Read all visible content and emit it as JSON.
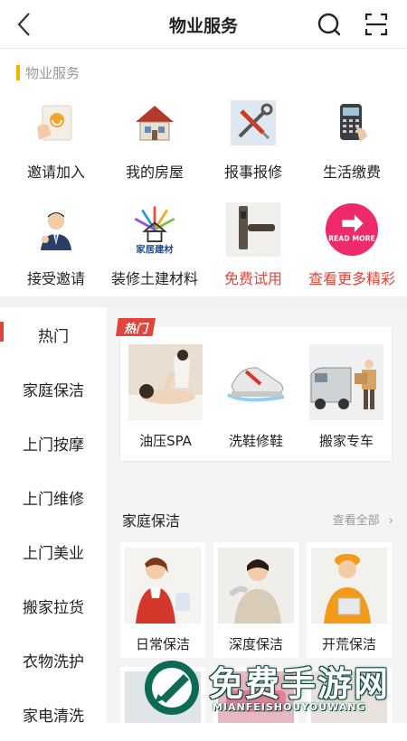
{
  "header": {
    "title": "物业服务",
    "back_icon": "back-arrow-icon",
    "search_icon": "search-icon",
    "scan_icon": "scan-icon"
  },
  "property": {
    "section_title": "物业服务",
    "items": [
      {
        "label": "邀请加入",
        "icon": "invite-card-icon"
      },
      {
        "label": "我的房屋",
        "icon": "house-icon"
      },
      {
        "label": "报事报修",
        "icon": "tools-icon"
      },
      {
        "label": "生活缴费",
        "icon": "payment-terminal-icon"
      },
      {
        "label": "接受邀请",
        "icon": "person-icon"
      },
      {
        "label": "装修土建材料",
        "icon": "building-materials-logo"
      },
      {
        "label": "免费试用",
        "icon": "smart-lock-icon"
      },
      {
        "label": "查看更多精彩",
        "icon": "read-more-icon"
      }
    ],
    "logo_text": "家居建材",
    "read_more_text": "READ MORE"
  },
  "categories": [
    "热门",
    "家庭保洁",
    "上门按摩",
    "上门维修",
    "上门美业",
    "搬家拉货",
    "衣物洗护",
    "家电清洗"
  ],
  "hot": {
    "tag": "热门",
    "items": [
      {
        "label": "油压SPA",
        "image": "spa-massage-photo"
      },
      {
        "label": "洗鞋修鞋",
        "image": "sneaker-photo"
      },
      {
        "label": "搬家专车",
        "image": "moving-van-photo"
      }
    ]
  },
  "cleaning": {
    "title": "家庭保洁",
    "more": "查看全部",
    "items": [
      {
        "label": "日常保洁",
        "image": "cleaner-photo"
      },
      {
        "label": "深度保洁",
        "image": "cleaner-duster-photo"
      },
      {
        "label": "开荒保洁",
        "image": "worker-photo"
      }
    ]
  },
  "watermark": {
    "text": "免费手游网",
    "sub": "MIANFEISHOUYOUWANG"
  },
  "colors": {
    "accent": "#e0443a",
    "section_bar": "#f2b400",
    "pink": "#ef2a6b"
  }
}
